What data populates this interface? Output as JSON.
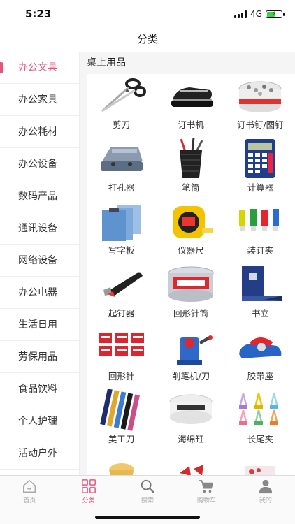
{
  "status": {
    "time": "5:23",
    "network": "4G"
  },
  "page": {
    "title": "分类"
  },
  "sidebar": {
    "items": [
      {
        "label": "办公文具"
      },
      {
        "label": "办公家具"
      },
      {
        "label": "办公耗材"
      },
      {
        "label": "办公设备"
      },
      {
        "label": "数码产品"
      },
      {
        "label": "通讯设备"
      },
      {
        "label": "网络设备"
      },
      {
        "label": "办公电器"
      },
      {
        "label": "生活日用"
      },
      {
        "label": "劳保用品"
      },
      {
        "label": "食品饮料"
      },
      {
        "label": "个人护理"
      },
      {
        "label": "活动户外"
      },
      {
        "label": ""
      }
    ]
  },
  "section": {
    "title": "桌上用品"
  },
  "products": [
    {
      "label": "剪刀",
      "icon": "scissors-icon"
    },
    {
      "label": "订书机",
      "icon": "stapler-icon"
    },
    {
      "label": "订书钉/图钉",
      "icon": "staples-icon"
    },
    {
      "label": "打孔器",
      "icon": "hole-punch-icon"
    },
    {
      "label": "笔筒",
      "icon": "pen-holder-icon"
    },
    {
      "label": "计算器",
      "icon": "calculator-icon"
    },
    {
      "label": "写字板",
      "icon": "clipboard-icon"
    },
    {
      "label": "仪器尺",
      "icon": "tape-measure-icon"
    },
    {
      "label": "装订夹",
      "icon": "binding-clip-icon"
    },
    {
      "label": "起钉器",
      "icon": "staple-remover-icon"
    },
    {
      "label": "回形针筒",
      "icon": "paperclip-tube-icon"
    },
    {
      "label": "书立",
      "icon": "bookend-icon"
    },
    {
      "label": "回形针",
      "icon": "paperclip-box-icon"
    },
    {
      "label": "削笔机/刀",
      "icon": "pencil-sharpener-icon"
    },
    {
      "label": "胶带座",
      "icon": "tape-dispenser-icon"
    },
    {
      "label": "美工刀",
      "icon": "utility-knife-icon"
    },
    {
      "label": "海绵缸",
      "icon": "sponge-cup-icon"
    },
    {
      "label": "长尾夹",
      "icon": "binder-clip-icon"
    },
    {
      "label": "",
      "icon": "product-image-icon"
    },
    {
      "label": "",
      "icon": "product-image-icon"
    },
    {
      "label": "",
      "icon": "product-image-icon"
    }
  ],
  "tabbar": {
    "items": [
      {
        "label": "首页",
        "icon": "home-icon"
      },
      {
        "label": "分类",
        "icon": "grid-icon"
      },
      {
        "label": "搜索",
        "icon": "search-icon"
      },
      {
        "label": "购物车",
        "icon": "cart-icon"
      },
      {
        "label": "我的",
        "icon": "person-icon"
      }
    ]
  },
  "colors": {
    "accent": "#e8537a",
    "inactive": "#aaaaaa"
  }
}
